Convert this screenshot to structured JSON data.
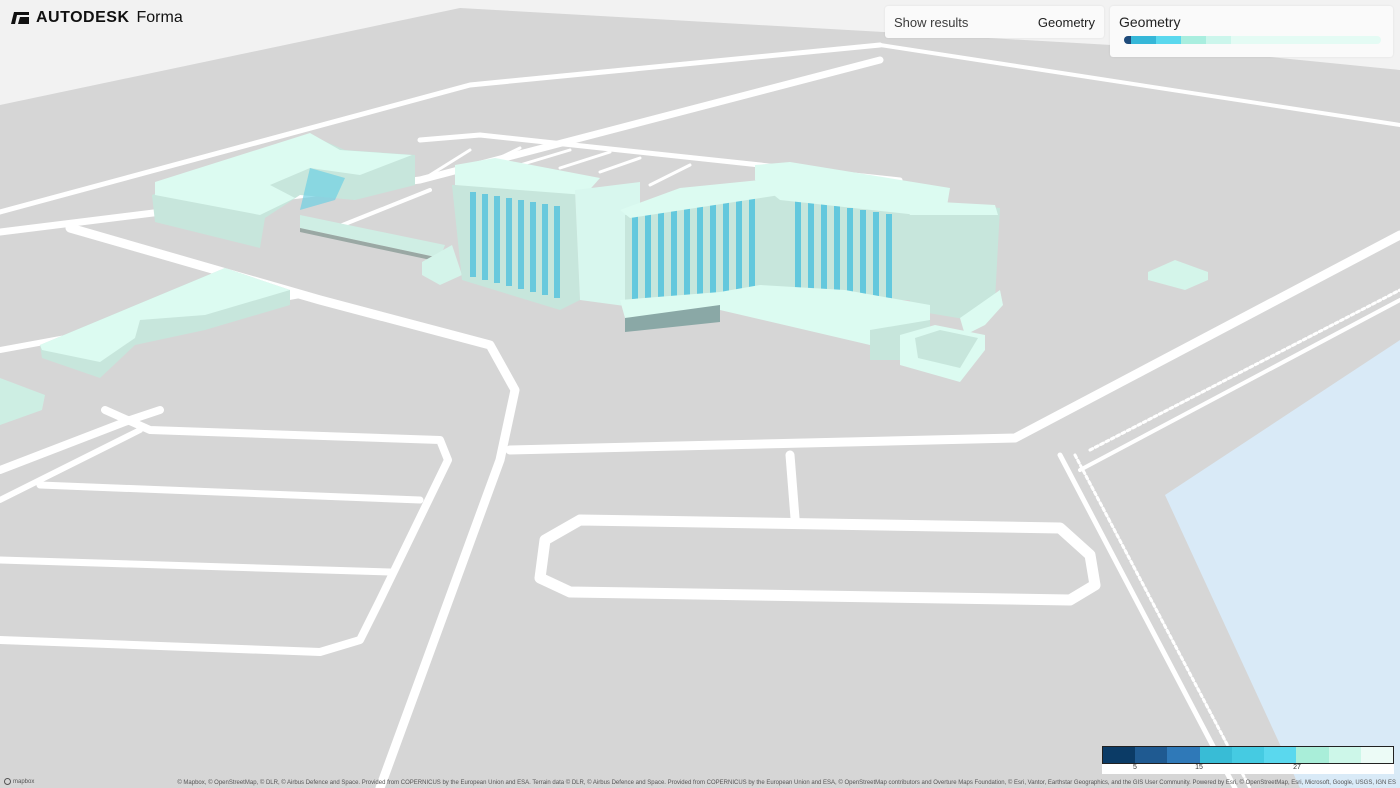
{
  "app": {
    "brand": "AUTODESK",
    "product": "Forma"
  },
  "toolbar": {
    "show_results_label": "Show results",
    "show_results_value": "Geometry"
  },
  "legend_panel": {
    "title": "Geometry",
    "bar_colors": [
      "#1e4a7a",
      "#35b7d8",
      "#5ad8ee",
      "#a9eedf",
      "#ccf6ec",
      "#e4fbf4",
      "#e4fbf4",
      "#e4fbf4"
    ]
  },
  "color_scale": {
    "colors": [
      "#0b3b66",
      "#1f5a91",
      "#2f79b8",
      "#38bcd6",
      "#45cbe2",
      "#5ad8ee",
      "#a9eed9",
      "#cdf7e9",
      "#ecfbf6"
    ],
    "tick_labels": [
      "5",
      "15",
      "27"
    ]
  },
  "attribution": "© Mapbox, © OpenStreetMap, © DLR, © Airbus Defence and Space. Provided from COPERNICUS by the European Union and ESA. Terrain data © DLR, © Airbus Defence and Space. Provided from COPERNICUS by the European Union and ESA, © OpenStreetMap contributors and Overture Maps Foundation, © Esri, Vantor, Earthstar Geographics, and the GIS User Community. Powered by Esri, © OpenStreetMap, Esri, Microsoft, Google, USGS, IGN ES",
  "mapbox_label": "mapbox",
  "colors": {
    "ground": "#d6d6d6",
    "road": "#ffffff",
    "water": "#d9eaf7",
    "building_top": "#dcfbf1",
    "building_side": "#c7e6dc",
    "facade_accent": "#4ec2de"
  }
}
